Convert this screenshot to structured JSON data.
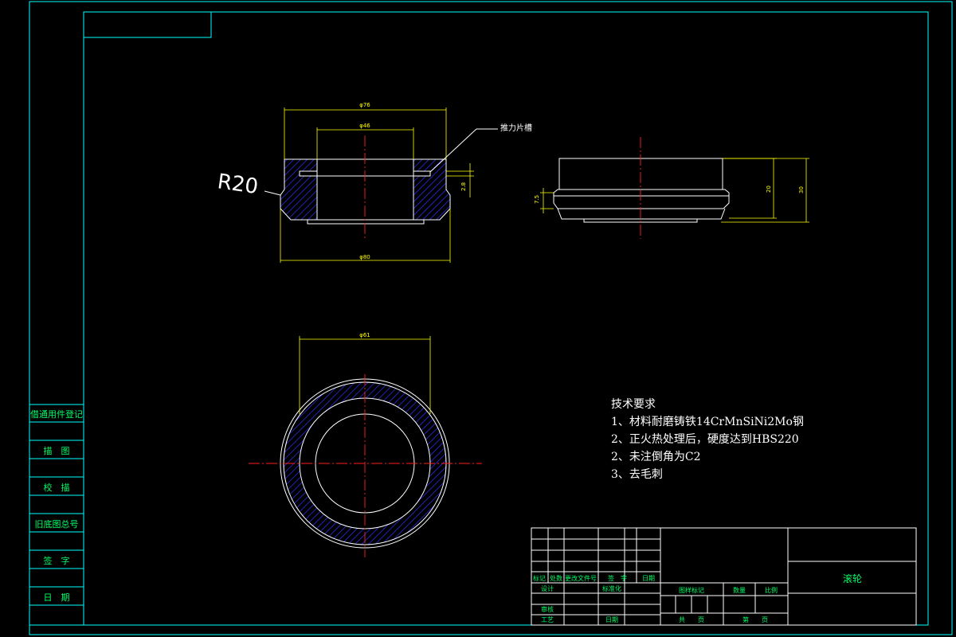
{
  "colors": {
    "background": "#000000",
    "frame": "#00ffff",
    "outline": "#ffffff",
    "dimension": "#ffff00",
    "centerline": "#ff2020",
    "hatch": "#3030ff",
    "label": "#00ff66"
  },
  "side_panel": {
    "items": [
      "借通用件登记",
      "描　图",
      "校　描",
      "旧底图总号",
      "签　字",
      "日　期"
    ]
  },
  "section_view": {
    "dim_outer_top": "φ76",
    "dim_inner_top": "φ46",
    "dim_bottom": "φ80",
    "dim_groove": "2.8",
    "callout_label": "推力片槽",
    "radius_label": "R20"
  },
  "side_view": {
    "dim_step": "7.5",
    "dim_height_inner": "20",
    "dim_height_total": "30"
  },
  "plan_view": {
    "dim_diameter": "φ61"
  },
  "tech_requirements": {
    "heading": "技术要求",
    "lines": [
      "1、材料耐磨铸铁14CrMnSiNi2Mo钢",
      "2、正火热处理后，硬度达到HBS220",
      "2、未注倒角为C2",
      "3、去毛刺"
    ]
  },
  "title_block": {
    "revision_headers": [
      "标记",
      "处数",
      "更改文件号",
      "签　字",
      "日期"
    ],
    "design": "设计",
    "standardize": "标准化",
    "review": "审核",
    "process": "工艺",
    "date": "日期",
    "stage_mark": "图样标记",
    "quantity": "数量",
    "scale": "比例",
    "total_sheets": "共　　页",
    "sheet_no": "第　　页",
    "part_name": "滚轮"
  }
}
